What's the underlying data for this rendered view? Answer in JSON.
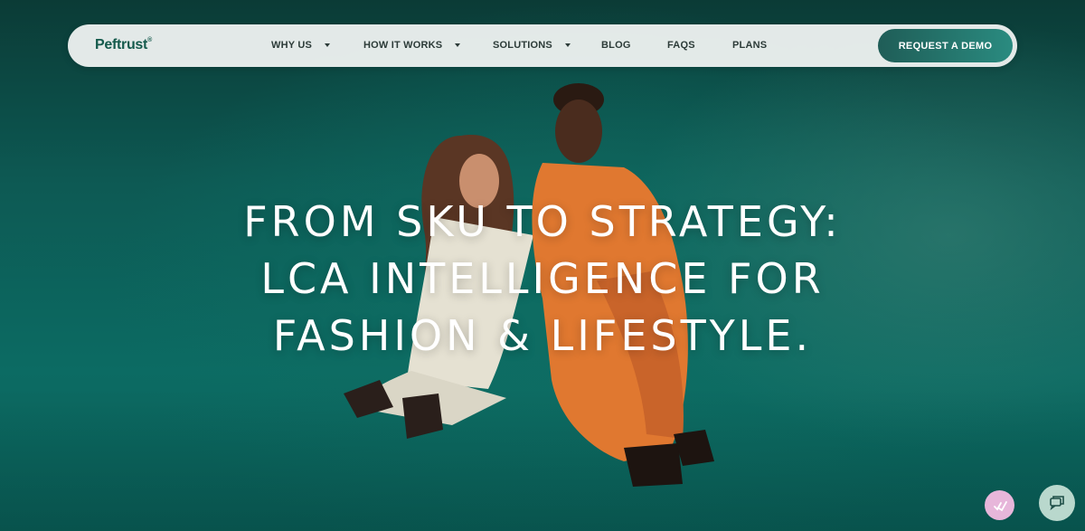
{
  "brand": {
    "name": "Peftrust",
    "mark": "®",
    "color": "#145a4c"
  },
  "nav": {
    "items": [
      {
        "label": "WHY US",
        "dropdown": true
      },
      {
        "label": "HOW IT WORKS",
        "dropdown": true
      },
      {
        "label": "SOLUTIONS",
        "dropdown": true
      },
      {
        "label": "BLOG",
        "dropdown": false
      },
      {
        "label": "FAQS",
        "dropdown": false
      },
      {
        "label": "PLANS",
        "dropdown": false
      }
    ],
    "cta_label": "REQUEST A DEMO"
  },
  "hero": {
    "headline_lines": [
      "FROM SKU TO STRATEGY:",
      "LCA INTELLIGENCE FOR",
      "FASHION & LIFESTYLE."
    ],
    "background_color": "#0c5a55"
  },
  "widgets": {
    "left_icon": "checklist-icon",
    "right_icon": "chat-icon"
  }
}
